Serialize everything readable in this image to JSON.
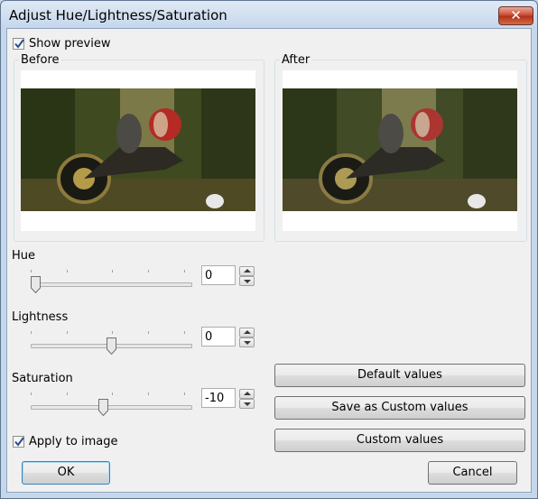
{
  "window": {
    "title": "Adjust Hue/Lightness/Saturation",
    "close_symbol": "✕"
  },
  "show_preview": {
    "label": "Show preview",
    "checked": true
  },
  "preview": {
    "before_label": "Before",
    "after_label": "After"
  },
  "hue": {
    "label": "Hue",
    "value": "0"
  },
  "lightness": {
    "label": "Lightness",
    "value": "0"
  },
  "saturation": {
    "label": "Saturation",
    "value": "-10"
  },
  "apply_to_image": {
    "label": "Apply to image",
    "checked": true
  },
  "buttons": {
    "default_values": "Default values",
    "save_custom": "Save as Custom values",
    "custom_values": "Custom values",
    "ok": "OK",
    "cancel": "Cancel"
  }
}
